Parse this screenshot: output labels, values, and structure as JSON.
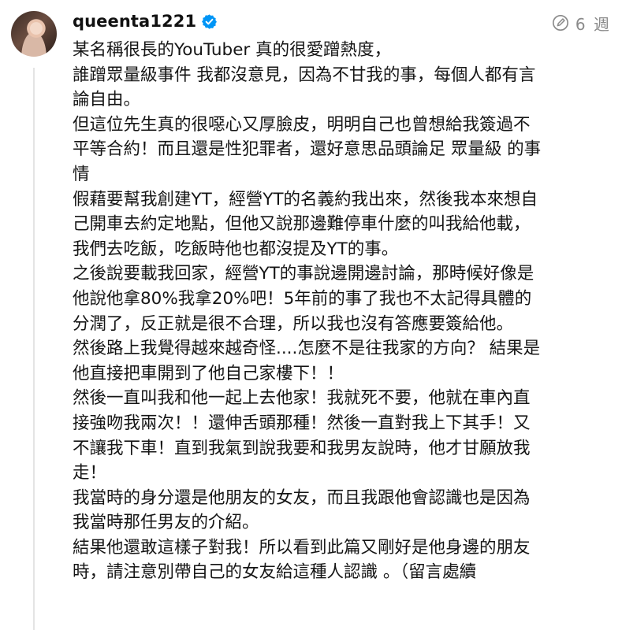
{
  "post": {
    "username": "queenta1221",
    "verified": true,
    "time_ago": "6 週",
    "icons": {
      "avatar": "user-avatar",
      "verified": "verified-badge-icon",
      "edited": "edit-pencil-icon"
    },
    "accent_color": "#0095f6",
    "lines": [
      "某名稱很長的YouTuber 真的很愛蹭熱度，",
      "誰蹭眾量級事件 我都沒意見，因為不甘我的事，每個人都有言",
      "論自由。",
      "但這位先生真的很噁心又厚臉皮，明明自己也曾想給我簽過不",
      "平等合約！而且還是性犯罪者，還好意思品頭論足 眾量級 的事",
      "情",
      "假藉要幫我創建YT，經營YT的名義約我出來，然後我本來想自",
      "己開車去約定地點，但他又說那邊難停車什麼的叫我給他載，",
      "我們去吃飯，吃飯時他也都沒提及YT的事。",
      "之後說要載我回家，經營YT的事說邊開邊討論，那時候好像是",
      "他說他拿80%我拿20%吧！5年前的事了我也不太記得具體的",
      "分潤了，反正就是很不合理，所以我也沒有答應要簽給他。",
      "然後路上我覺得越來越奇怪....怎麼不是往我家的方向？ 結果是",
      "他直接把車開到了他自己家樓下！！",
      "然後一直叫我和他一起上去他家！我就死不要，他就在車內直",
      "接強吻我兩次！！還伸舌頭那種！然後一直對我上下其手！又",
      "不讓我下車！直到我氣到說我要和我男友說時，他才甘願放我",
      "走！",
      "我當時的身分還是他朋友的女友，而且我跟他會認識也是因為",
      "我當時那任男友的介紹。",
      "結果他還敢這樣子對我！所以看到此篇又剛好是他身邊的朋友",
      "時，請注意別帶自己的女友給這種人認識 。（留言處續"
    ]
  }
}
